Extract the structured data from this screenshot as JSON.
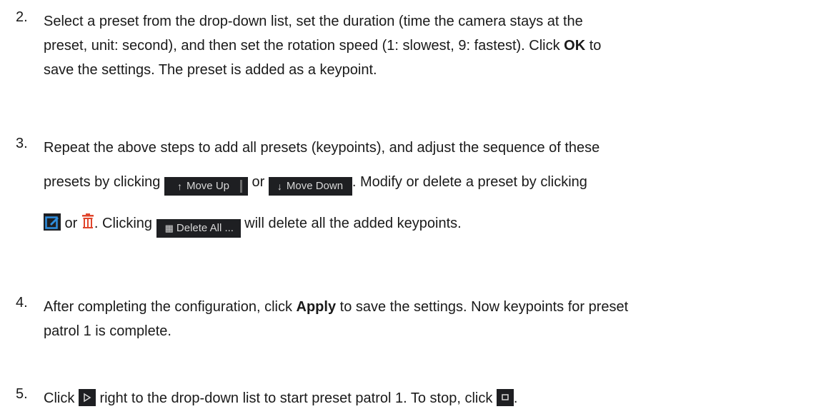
{
  "steps": [
    {
      "num": "2.",
      "l1": "Select a preset from the drop-down list, set the duration (time the camera stays at the",
      "l2_a": "preset, unit: second), and then set the rotation speed (1: slowest, 9: fastest). Click ",
      "l2_bold": "OK",
      "l2_b": " to",
      "l3": "save the settings. The preset is added as a keypoint."
    },
    {
      "num": "3.",
      "l1": "Repeat the above steps to add all presets (keypoints), and adjust the sequence of these",
      "l2_a": "presets by clicking ",
      "l2_b": " or ",
      "l2_c": ". Modify or delete a preset by clicking",
      "l3_a": " or ",
      "l3_b": ". Clicking ",
      "l3_c": " will delete all the added keypoints."
    },
    {
      "num": "4.",
      "l1_a": "After completing the configuration, click ",
      "l1_bold": "Apply",
      "l1_b": " to save the settings. Now keypoints for preset",
      "l2": "patrol 1 is complete."
    },
    {
      "num": "5.",
      "l1_a": "Click ",
      "l1_b": " right to the drop-down list to start preset patrol 1. To stop, click ",
      "l1_c": "."
    }
  ],
  "buttons": {
    "move_up": "Move Up",
    "move_down": "Move Down",
    "delete_all": "Delete All ..."
  },
  "icons": {
    "move_up": "arrow-up-icon",
    "move_down": "arrow-down-icon",
    "edit": "edit-icon",
    "delete": "trash-icon",
    "delete_all": "trash-icon",
    "play": "play-icon",
    "stop": "stop-icon"
  },
  "colors": {
    "button_bg": "#1e1f22",
    "button_text": "#d8d8d8",
    "edit_accent": "#2f8fe0",
    "trash_accent": "#e0452c"
  }
}
